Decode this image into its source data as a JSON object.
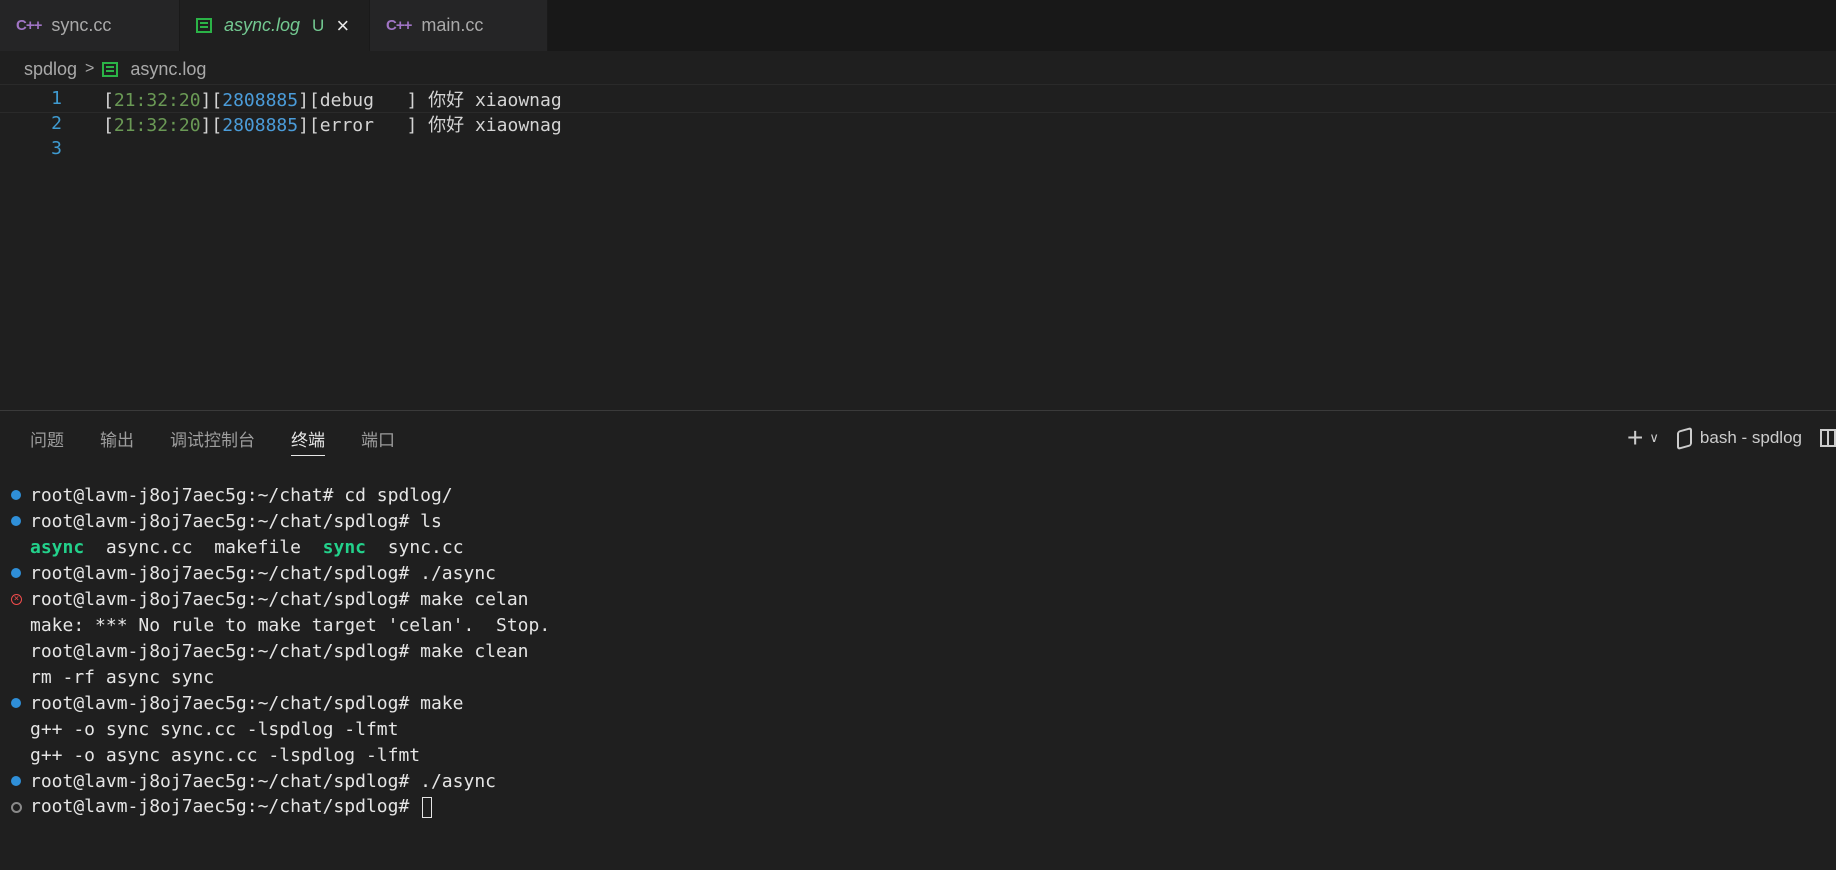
{
  "tabs": [
    {
      "label": "sync.cc",
      "icon": "cpp-file-icon"
    },
    {
      "label": "async.log",
      "icon": "log-file-icon",
      "status": "U",
      "close": "×"
    },
    {
      "label": "main.cc",
      "icon": "cpp-file-icon"
    }
  ],
  "breadcrumb": {
    "folder": "spdlog",
    "file": "async.log"
  },
  "editor": {
    "lines": [
      {
        "number": "1",
        "bracket_open": "[",
        "time": "21:32:20",
        "mid": "][",
        "pid": "2808885",
        "rest": "][debug   ] 你好 xiaownag"
      },
      {
        "number": "2",
        "bracket_open": "[",
        "time": "21:32:20",
        "mid": "][",
        "pid": "2808885",
        "rest": "][error   ] 你好 xiaownag"
      },
      {
        "number": "3"
      }
    ]
  },
  "panel": {
    "tabs": [
      "问题",
      "输出",
      "调试控制台",
      "终端",
      "端口"
    ],
    "active_tab": "终端",
    "terminal_name": "bash - spdlog"
  },
  "terminal": {
    "lines": [
      {
        "marker": "success",
        "text": "root@lavm-j8oj7aec5g:~/chat# cd spdlog/"
      },
      {
        "marker": "success",
        "text": "root@lavm-j8oj7aec5g:~/chat/spdlog# ls"
      },
      {
        "marker": "none",
        "ls": [
          "async",
          "async.cc",
          "makefile",
          "sync",
          "sync.cc"
        ]
      },
      {
        "marker": "success",
        "text": "root@lavm-j8oj7aec5g:~/chat/spdlog# ./async"
      },
      {
        "marker": "error",
        "text": "root@lavm-j8oj7aec5g:~/chat/spdlog# make celan"
      },
      {
        "marker": "none",
        "text": "make: *** No rule to make target 'celan'.  Stop."
      },
      {
        "marker": "none",
        "text": "root@lavm-j8oj7aec5g:~/chat/spdlog# make clean"
      },
      {
        "marker": "none",
        "text": "rm -rf async sync"
      },
      {
        "marker": "success",
        "text": "root@lavm-j8oj7aec5g:~/chat/spdlog# make"
      },
      {
        "marker": "none",
        "text": "g++ -o sync sync.cc -lspdlog -lfmt"
      },
      {
        "marker": "none",
        "text": "g++ -o async async.cc -lspdlog -lfmt"
      },
      {
        "marker": "success",
        "text": "root@lavm-j8oj7aec5g:~/chat/spdlog# ./async"
      },
      {
        "marker": "pending",
        "text": "root@lavm-j8oj7aec5g:~/chat/spdlog# "
      }
    ]
  },
  "colors": {
    "accent": "#73c991",
    "ts": "#6a9955",
    "pid": "#4b9cd9",
    "exe": "#23d18b",
    "error": "#f14c4c"
  }
}
